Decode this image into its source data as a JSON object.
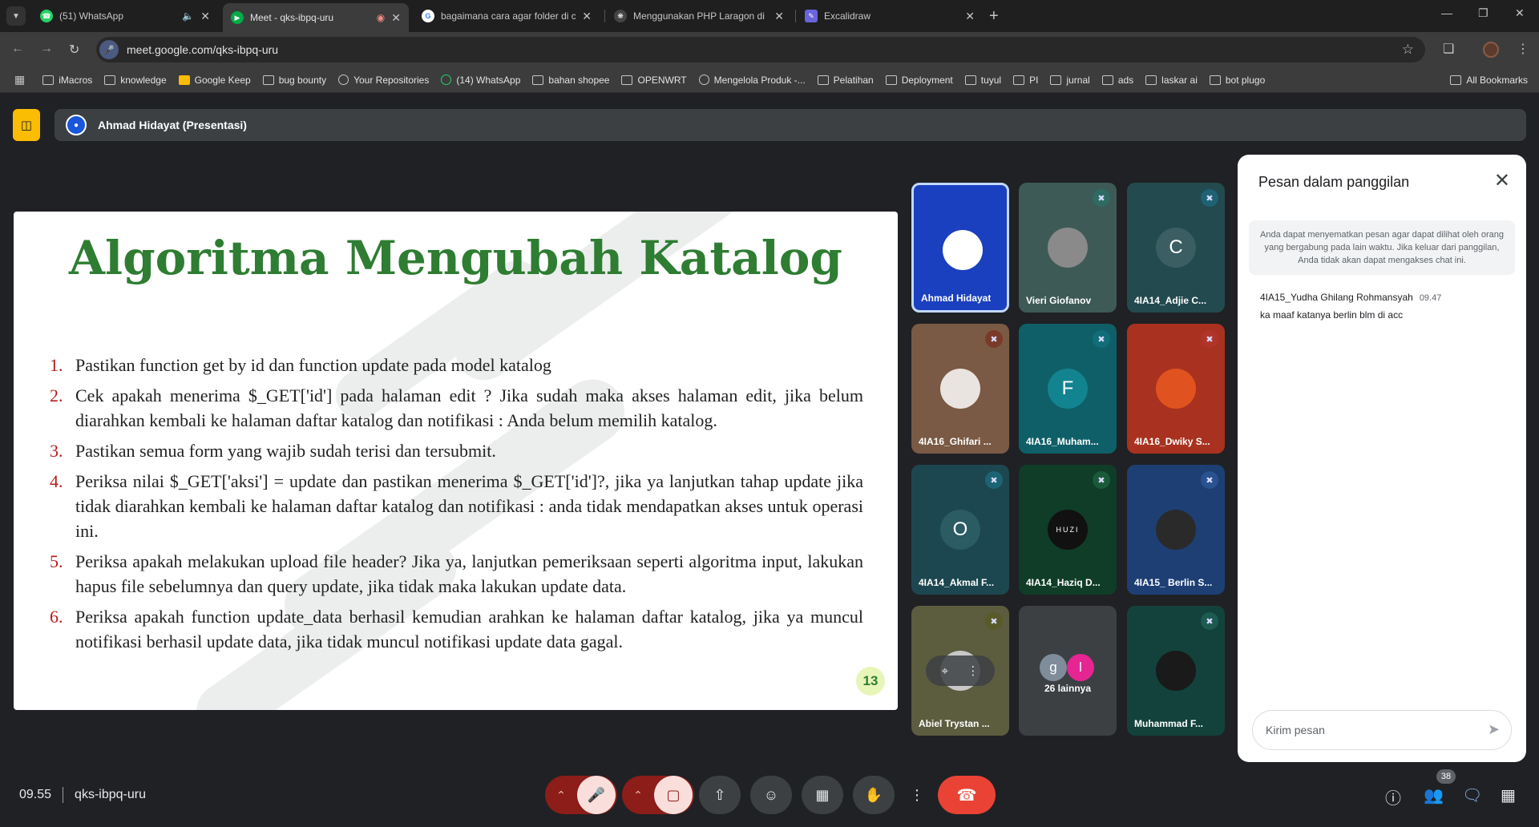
{
  "browser": {
    "tabs": [
      {
        "title": "(51) WhatsApp",
        "favicon": "whatsapp-icon",
        "color": "#25d366",
        "badge": "51"
      },
      {
        "title": "Meet - qks-ibpq-uru",
        "favicon": "meet-icon",
        "color": "#00ac47",
        "active": true
      },
      {
        "title": "bagaimana cara agar folder di c",
        "favicon": "google-icon",
        "color": "#4285f4"
      },
      {
        "title": "Menggunakan PHP Laragon di",
        "favicon": "openai-icon",
        "color": "#ffffff"
      },
      {
        "title": "Excalidraw",
        "favicon": "excalidraw-icon",
        "color": "#6965db"
      }
    ],
    "url": "meet.google.com/qks-ibpq-uru",
    "bookmarks": [
      {
        "label": "iMacros",
        "icon": "folder-icon"
      },
      {
        "label": "knowledge",
        "icon": "folder-icon"
      },
      {
        "label": "Google Keep",
        "icon": "keep-icon"
      },
      {
        "label": "bug bounty",
        "icon": "folder-icon"
      },
      {
        "label": "Your Repositories",
        "icon": "github-icon"
      },
      {
        "label": "(14) WhatsApp",
        "icon": "whatsapp-icon"
      },
      {
        "label": "bahan shopee",
        "icon": "folder-icon"
      },
      {
        "label": "OPENWRT",
        "icon": "folder-icon"
      },
      {
        "label": "Mengelola Produk -...",
        "icon": "globe-icon"
      },
      {
        "label": "Pelatihan",
        "icon": "folder-icon"
      },
      {
        "label": "Deployment",
        "icon": "folder-icon"
      },
      {
        "label": "tuyul",
        "icon": "folder-icon"
      },
      {
        "label": "PI",
        "icon": "folder-icon"
      },
      {
        "label": "jurnal",
        "icon": "folder-icon"
      },
      {
        "label": "ads",
        "icon": "folder-icon"
      },
      {
        "label": "laskar ai",
        "icon": "folder-icon"
      },
      {
        "label": "bot plugo",
        "icon": "folder-icon"
      }
    ],
    "all_bookmarks": "All Bookmarks"
  },
  "meet": {
    "presenter": "Ahmad Hidayat (Presentasi)",
    "slide": {
      "title": "Algoritma Mengubah Katalog",
      "items": [
        {
          "num": "1.",
          "text": "Pastikan function get by id dan function update pada model katalog"
        },
        {
          "num": "2.",
          "text": "Cek apakah menerima $_GET['id'] pada halaman edit ? Jika sudah maka akses halaman edit, jika belum diarahkan kembali ke halaman daftar katalog dan notifikasi : Anda belum memilih katalog."
        },
        {
          "num": "3.",
          "text": "Pastikan semua form yang wajib sudah terisi dan tersubmit."
        },
        {
          "num": "4.",
          "text": "Periksa nilai $_GET['aksi'] = update dan pastikan menerima $_GET['id']?, jika ya lanjutkan tahap update jika tidak diarahkan kembali ke halaman daftar katalog dan notifikasi : anda tidak mendapatkan akses untuk operasi ini."
        },
        {
          "num": "5.",
          "text": "Periksa apakah melakukan upload file header? Jika ya, lanjutkan pemeriksaan seperti algoritma input, lakukan hapus file sebelumnya dan query update, jika tidak maka lakukan update data."
        },
        {
          "num": "6.",
          "text": "Periksa apakah function update_data berhasil kemudian arahkan ke halaman daftar katalog, jika ya muncul notifikasi berhasil update data, jika tidak muncul notifikasi update data gagal."
        }
      ],
      "page": "13"
    },
    "participants": [
      {
        "name": "Ahmad Hidayat",
        "initial": "",
        "bg": "#1a3fbf",
        "av": "#ffffff",
        "muted": false,
        "speaking": true
      },
      {
        "name": "Vieri Giofanov",
        "initial": "",
        "bg": "#3d5a56",
        "av": "#8a8a8a",
        "muted": true,
        "mute_color": "#2d6b63"
      },
      {
        "name": "4IA14_Adjie C...",
        "initial": "C",
        "bg": "#234a4f",
        "av": "#3a5e62",
        "muted": true,
        "mute_color": "#1f6273"
      },
      {
        "name": "4IA16_Ghifari ...",
        "initial": "",
        "bg": "#7a5a44",
        "av": "#e9e4df",
        "muted": true,
        "mute_color": "#7a3a2a"
      },
      {
        "name": "4IA16_Muham...",
        "initial": "F",
        "bg": "#0f5f68",
        "av": "#12848f",
        "muted": true,
        "mute_color": "#116d78"
      },
      {
        "name": "4IA16_Dwiky S...",
        "initial": "",
        "bg": "#a8321f",
        "av": "#e0521f",
        "muted": true,
        "mute_color": "#b1342a"
      },
      {
        "name": "4IA14_Akmal F...",
        "initial": "O",
        "bg": "#1d4750",
        "av": "#2b5b63",
        "muted": true,
        "mute_color": "#1c6474"
      },
      {
        "name": "4IA14_Haziq D...",
        "initial": "HUZI",
        "bg": "#0f3d28",
        "av": "#111111",
        "muted": true,
        "mute_color": "#1a5a3a"
      },
      {
        "name": "4IA15_ Berlin S...",
        "initial": "",
        "bg": "#1e3f74",
        "av": "#2a2a2a",
        "muted": true,
        "mute_color": "#2a5190"
      },
      {
        "name": "Abiel Trystan ...",
        "initial": "",
        "bg": "#5c5c3f",
        "av": "#c8c8c8",
        "muted": true,
        "mute_color": "#585a2a",
        "hover": true
      },
      {
        "name": "26 lainnya",
        "more": true,
        "bg": "#3c4043",
        "avs": [
          {
            "letter": "g",
            "color": "#7f8c9a"
          },
          {
            "letter": "l",
            "color": "#e52592"
          }
        ]
      },
      {
        "name": "Muhammad F...",
        "initial": "",
        "bg": "#12423b",
        "av": "#1a1a1a",
        "muted": true,
        "mute_color": "#1c5a52"
      }
    ],
    "chat": {
      "title": "Pesan dalam panggilan",
      "notice": "Anda dapat menyematkan pesan agar dapat dilihat oleh orang yang bergabung pada lain waktu. Jika keluar dari panggilan, Anda tidak akan dapat mengakses chat ini.",
      "messages": [
        {
          "sender": "4IA15_Yudha Ghilang Rohmansyah",
          "time": "09.47",
          "text": "ka maaf katanya berlin blm di acc"
        }
      ],
      "input_placeholder": "Kirim pesan"
    },
    "bottom": {
      "time": "09.55",
      "meeting_code": "qks-ibpq-uru",
      "participant_count": "38"
    },
    "colors": {
      "accent_green": "#2e7d32",
      "mic_red": "#f9dedc",
      "end_call": "#ea4335",
      "present_yellow": "#fbbc04"
    }
  }
}
